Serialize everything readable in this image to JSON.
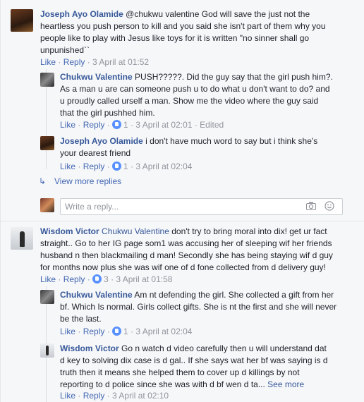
{
  "thread1": {
    "comment": {
      "author": "Joseph Ayo Olamide",
      "lines": [
        "@chukwu valentine God will save the just not the",
        "heartless you push person to kill and you said she isn't part of them why you",
        "people like to play with Jesus like toys for it is written \"no sinner shall go",
        "unpunished``"
      ],
      "like": "Like",
      "reply": "Reply",
      "time": "3 April at 01:52"
    },
    "replies": [
      {
        "author": "Chukwu Valentine",
        "lines": [
          "PUSH?????. Did the guy say that the girl push him?.",
          "As a man u are can someone push u to do what u don't want to do? and",
          "u proudly called urself a man. Show me the video where the guy said",
          "that the girl pushhed him."
        ],
        "like": "Like",
        "reply": "Reply",
        "reactions": "1",
        "time": "3 April at 02:01",
        "edited": "Edited"
      },
      {
        "author": "Joseph Ayo Olamide",
        "lines": [
          "i don't have much word to say but i think she's",
          "your dearest friend"
        ],
        "like": "Like",
        "reply": "Reply",
        "reactions": "1",
        "time": "3 April at 02:04"
      }
    ],
    "view_more": "View more replies",
    "input_placeholder": "Write a reply..."
  },
  "thread2": {
    "comment": {
      "author": "Wisdom Victor",
      "mention": "Chukwu Valentine",
      "lines": [
        "don't try to bring moral into dix! get ur fact",
        "straight.. Go to her IG page som1 was accusing her of sleeping wif her friends",
        "husband n then blackmailing d man! Secondly she has being staying wif d guy",
        "for months now plus she was wif one of d fone collected from d delivery guy!"
      ],
      "like": "Like",
      "reply": "Reply",
      "reactions": "3",
      "time": "3 April at 01:58"
    },
    "replies": [
      {
        "author": "Chukwu Valentine",
        "lines": [
          "Am nt defending the girl. She collected a gift from her",
          "bf. Which Is normal. Girls collect gifts. She is nt the first and she will never",
          "be the last."
        ],
        "like": "Like",
        "reply": "Reply",
        "reactions": "1",
        "time": "3 April at 02:04"
      },
      {
        "author": "Wisdom Victor",
        "lines": [
          "Go n watch d video carefully then u will understand dat",
          "d key to solving dix case is d gal.. If she says wat her bf was saying is d",
          "truth then it means she helped them to cover up d killings by not",
          "reporting to d police since she was with d bf wen d ta..."
        ],
        "see_more": "See more",
        "like": "Like",
        "reply": "Reply",
        "time": "3 April at 02:10"
      }
    ]
  },
  "colors": {
    "link": "#365899",
    "action": "#4267b2",
    "meta": "#90949c",
    "like_badge": "#5890ff"
  }
}
